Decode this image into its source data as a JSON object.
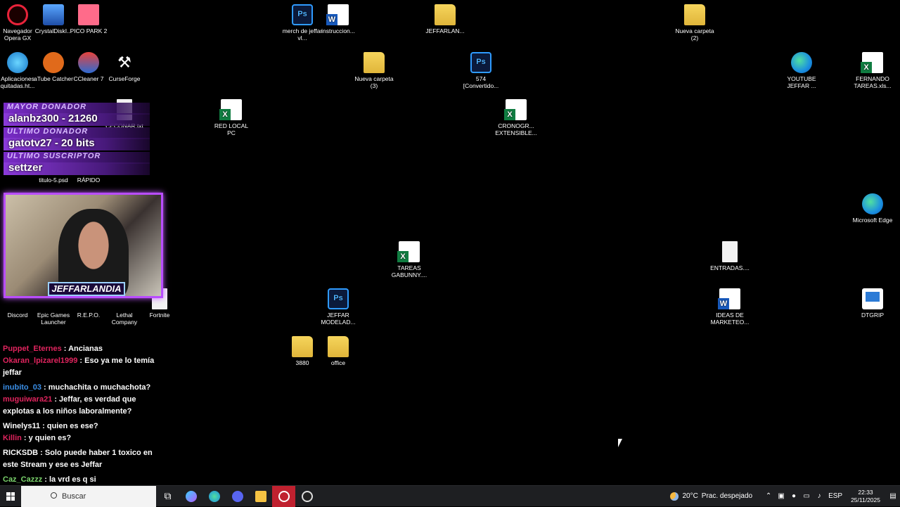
{
  "desktop_icons": [
    {
      "key": "opera",
      "label": "Navegador Opera GX",
      "type": "opera"
    },
    {
      "key": "crystal",
      "label": "CrystalDiskI...",
      "type": "crystal"
    },
    {
      "key": "pico",
      "label": "PICO PARK 2",
      "type": "pico"
    },
    {
      "key": "merch",
      "label": "merch de jeffar vl...",
      "type": "ps"
    },
    {
      "key": "instrucciones",
      "label": "instruccion...",
      "type": "word"
    },
    {
      "key": "jeffarlan",
      "label": "JEFFARLAN...",
      "type": "folder"
    },
    {
      "key": "nueva2",
      "label": "Nueva carpeta (2)",
      "type": "folder"
    },
    {
      "key": "apps",
      "label": "Aplicaciones quitadas.ht...",
      "type": "ie"
    },
    {
      "key": "atube",
      "label": "aTube Catcher",
      "type": "atube"
    },
    {
      "key": "ccleaner",
      "label": "CCleaner 7",
      "type": "ccleaner"
    },
    {
      "key": "curse",
      "label": "CurseForge",
      "type": "curse"
    },
    {
      "key": "nueva3",
      "label": "Nueva carpeta (3)",
      "type": "folder"
    },
    {
      "key": "ps574",
      "label": "574 [Convertido...",
      "type": "ps"
    },
    {
      "key": "youtube",
      "label": "YOUTUBE JEFFAR ...",
      "type": "edge"
    },
    {
      "key": "fernando",
      "label": "FERNANDO TAREAS.xls...",
      "type": "excel"
    },
    {
      "key": "ceconar",
      "label": "CECONAR.txt",
      "type": "txt"
    },
    {
      "key": "redlocal",
      "label": "RED LOCAL PC",
      "type": "excel"
    },
    {
      "key": "cronogr",
      "label": "CRONOGR... EXTENSIBLE...",
      "type": "excel"
    },
    {
      "key": "sintitulo",
      "label": "titulo-5.psd",
      "type": "generic"
    },
    {
      "key": "acceso",
      "label": "RÁPIDO",
      "type": "generic"
    },
    {
      "key": "edge",
      "label": "Microsoft Edge",
      "type": "edge"
    },
    {
      "key": "tareas",
      "label": "TAREAS GABUNNY....",
      "type": "excel"
    },
    {
      "key": "entradas",
      "label": "ENTRADAS....",
      "type": "txt"
    },
    {
      "key": "discord",
      "label": "Discord",
      "type": "generic"
    },
    {
      "key": "epic",
      "label": "Epic Games Launcher",
      "type": "generic"
    },
    {
      "key": "repo",
      "label": "R.E.P.O.",
      "type": "generic"
    },
    {
      "key": "lethal",
      "label": "Lethal Company",
      "type": "generic"
    },
    {
      "key": "fortnite",
      "label": "Fortnite",
      "type": "txt"
    },
    {
      "key": "jeffarmodel",
      "label": "JEFFAR MODELAD...",
      "type": "ps"
    },
    {
      "key": "ideas",
      "label": "IDEAS DE MARKETEO...",
      "type": "word"
    },
    {
      "key": "dtgrip",
      "label": "DTGRIP",
      "type": "dtgrip"
    },
    {
      "key": "f3880",
      "label": "3880",
      "type": "folder"
    },
    {
      "key": "office",
      "label": "office",
      "type": "folder"
    }
  ],
  "overlay": {
    "top_donor_heading": "MAYOR DONADOR",
    "top_donor_value": "alanbz300 - 21260",
    "last_donor_heading": "ULTIMO DONADOR",
    "last_donor_value": "gatotv27 - 20 bits",
    "last_sub_heading": "ULTIMO SUSCRIPTOR",
    "last_sub_value": "settzer"
  },
  "webcam": {
    "banner": "JEFFARLANDIA"
  },
  "chat": [
    {
      "user": "Puppet_Eternes",
      "user_color": "#e0245e",
      "text": "Ancianas"
    },
    {
      "user": "Okaran_lpizarel1999",
      "user_color": "#e0245e",
      "text": "Eso ya me lo temía jeffar"
    },
    {
      "user": "inubito_03",
      "user_color": "#3a8ee6",
      "text": "muchachita o muchachota?"
    },
    {
      "user": "muguiwara21",
      "user_color": "#e0245e",
      "text": "Jeffar, es verdad que explotas a los niños laboralmente?"
    },
    {
      "user": "Winelys11",
      "user_color": "#ffffff",
      "text": "quien es ese?"
    },
    {
      "user": "Killin",
      "user_color": "#e0245e",
      "text": "y quien es?"
    },
    {
      "user": "RICKSDB",
      "user_color": "#ffffff",
      "text": "Solo puede haber 1 toxico en este Stream y ese es Jeffar"
    },
    {
      "user": "Caz_Cazzz",
      "user_color": "#7ad36b",
      "text": "la vrd es q si"
    }
  ],
  "taskbar": {
    "search_label": "Buscar",
    "weather_temp": "20°C",
    "weather_desc": "Prac. despejado",
    "language": "ESP",
    "time": "22:33",
    "date": "25/11/2025"
  }
}
